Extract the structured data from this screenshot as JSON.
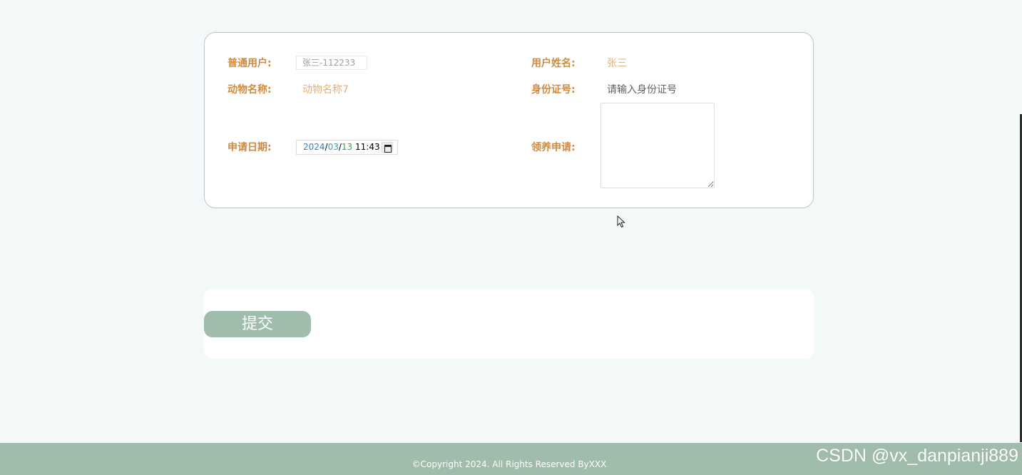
{
  "form": {
    "user_label": "普通用户:",
    "user_value": "张三-112233",
    "username_label": "用户姓名:",
    "username_value": "张三",
    "animal_label": "动物名称:",
    "animal_value": "动物名称7",
    "idcard_label": "身份证号:",
    "idcard_placeholder": "请输入身份证号",
    "date_label": "申请日期:",
    "date_year": "2024",
    "date_month": "03",
    "date_day": "13",
    "date_time": "11:43",
    "date_sep": "/",
    "apply_label": "领养申请:"
  },
  "actions": {
    "submit_label": "提交"
  },
  "footer": {
    "copyright": "©Copyright 2024. All Rights Reserved ByXXX",
    "watermark": "CSDN @vx_danpianji889"
  },
  "colors": {
    "label": "#d08a3f",
    "value": "#e3b178",
    "accent": "#a0bcaa",
    "background": "#f3f8f8"
  }
}
